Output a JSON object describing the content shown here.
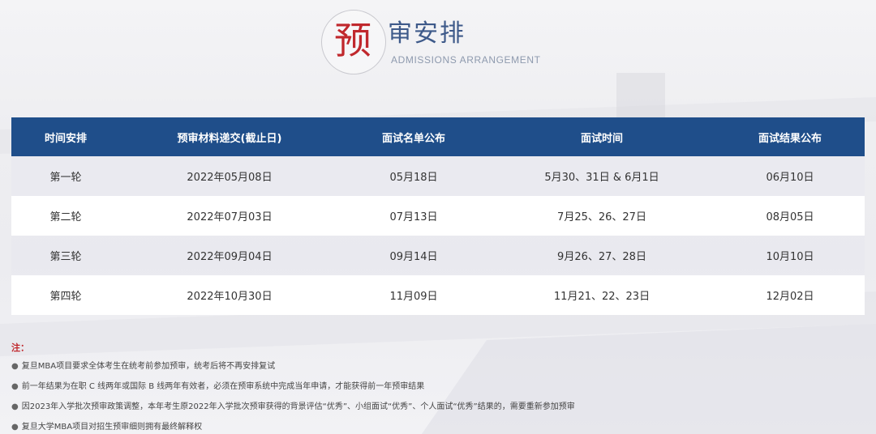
{
  "header": {
    "title_first_char": "预",
    "title_rest": "审安排",
    "title_en": "ADMISSIONS ARRANGEMENT"
  },
  "table": {
    "headers": [
      "时间安排",
      "预审材料递交(截止日)",
      "面试名单公布",
      "面试时间",
      "面试结果公布"
    ],
    "rows": [
      [
        "第一轮",
        "2022年05月08日",
        "05月18日",
        "5月30、31日 & 6月1日",
        "06月10日"
      ],
      [
        "第二轮",
        "2022年07月03日",
        "07月13日",
        "7月25、26、27日",
        "08月05日"
      ],
      [
        "第三轮",
        "2022年09月04日",
        "09月14日",
        "9月26、27、28日",
        "10月10日"
      ],
      [
        "第四轮",
        "2022年10月30日",
        "11月09日",
        "11月21、22、23日",
        "12月02日"
      ]
    ]
  },
  "notes": {
    "title": "注：",
    "items": [
      "复旦MBA项目要求全体考生在统考前参加预审，统考后将不再安排复试",
      "前一年结果为在职 C 线两年或国际 B 线两年有效者，必须在预审系统中完成当年申请，才能获得前一年预审结果",
      "因2023年入学批次预审政策调整，本年考生原2022年入学批次预审获得的背景评估“优秀”、小组面试“优秀”、个人面试“优秀”结果的，需要重新参加预审",
      "复旦大学MBA项目对招生预审细则拥有最终解释权"
    ]
  },
  "colors": {
    "header_bg": "#1f4e8a",
    "accent_red": "#c0282d",
    "title_blue": "#3e5a8a"
  }
}
